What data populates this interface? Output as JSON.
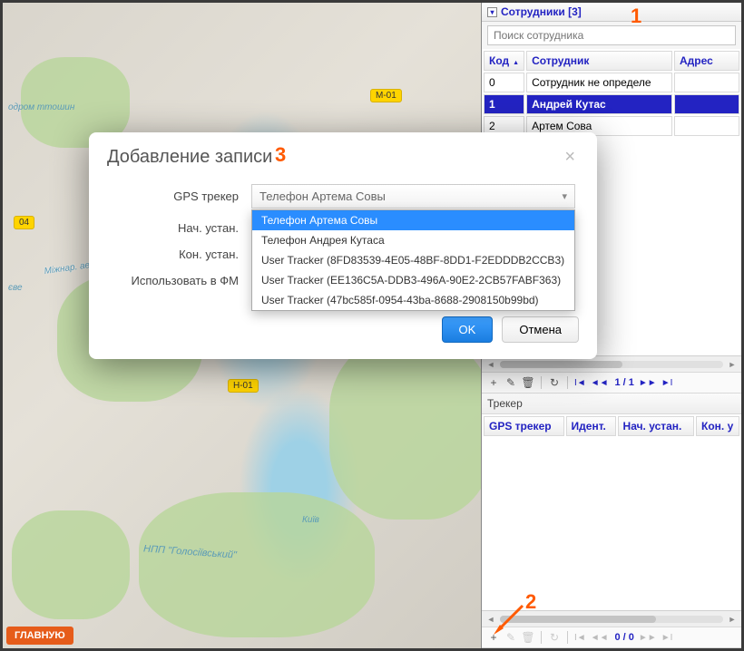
{
  "map": {
    "roads": {
      "m01": "М-01",
      "e04": "04",
      "h01": "Н-01"
    },
    "labels": {
      "airport": "Міжнар.\nаеропорт\nімені\nСікорсько",
      "park": "НПП \"Голосіївський\"",
      "city": "Київ",
      "west1": "одром\nттошин",
      "west2": "єве"
    },
    "home_button": "ГЛАВНУЮ"
  },
  "employees": {
    "title": "Сотрудники [3]",
    "search_placeholder": "Поиск сотрудника",
    "columns": {
      "code": "Код",
      "employee": "Сотрудник",
      "address": "Адрес"
    },
    "rows": [
      {
        "code": "0",
        "name": "Сотрудник не определе",
        "address": ""
      },
      {
        "code": "1",
        "name": "Андрей Кутас",
        "address": ""
      },
      {
        "code": "2",
        "name": "Артем Сова",
        "address": ""
      }
    ],
    "pager": "1 / 1"
  },
  "tracker_panel": {
    "title": "Трекер",
    "columns": {
      "gps": "GPS трекер",
      "ident": "Идент.",
      "start": "Нач. устан.",
      "end": "Кон. у"
    },
    "pager": "0 / 0"
  },
  "modal": {
    "title": "Добавление записи",
    "labels": {
      "gps": "GPS трекер",
      "start": "Нач. устан.",
      "end": "Кон. устан.",
      "use_fm": "Использовать в ФМ"
    },
    "selected": "Телефон Артема Совы",
    "options": [
      "Телефон Артема Совы",
      "Телефон Андрея Кутаса",
      "User Tracker (8FD83539-4E05-48BF-8DD1-F2EDDDB2CCB3)",
      "User Tracker (EE136C5A-DDB3-496A-90E2-2CB57FABF363)",
      "User Tracker (47bc585f-0954-43ba-8688-2908150b99bd)"
    ],
    "buttons": {
      "ok": "OK",
      "cancel": "Отмена"
    }
  },
  "annotations": {
    "a1": "1",
    "a2": "2",
    "a3": "3"
  }
}
